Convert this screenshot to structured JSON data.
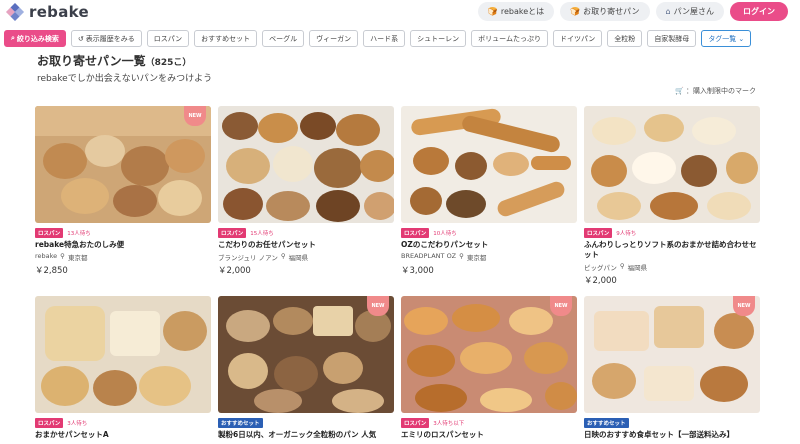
{
  "header": {
    "logo_text": "rebake",
    "nav": [
      {
        "label": "rebakeとは",
        "icon": "bread-icon"
      },
      {
        "label": "お取り寄せパン",
        "icon": "bread-icon"
      },
      {
        "label": "パン屋さん",
        "icon": "shop-icon"
      }
    ],
    "login_label": "ログイン"
  },
  "filters": {
    "refine_label": "絞り込み検索",
    "history_label": "表示履歴をみる",
    "tags": [
      "ロスパン",
      "おすすめセット",
      "ベーグル",
      "ヴィーガン",
      "ハード系",
      "シュトーレン",
      "ボリュームたっぷり",
      "ドイツパン",
      "全粒粉",
      "自家製酵母"
    ],
    "tag_list_label": "タグ一覧"
  },
  "main": {
    "title": "お取り寄せパン一覧",
    "count": "（825こ）",
    "subtitle": "rebakeでしか出会えないパンをみつけよう",
    "legend_label": "：購入制限中のマーク"
  },
  "products": [
    {
      "new": "NEW",
      "category": "ロスパン",
      "category_color": "#e23a73",
      "wait": "13人待ち",
      "name": "rebake特急おたのしみ便",
      "shop": "rebake",
      "location": "東京都",
      "price": "￥2,850"
    },
    {
      "new": "",
      "category": "ロスパン",
      "category_color": "#e23a73",
      "wait": "15人待ち",
      "name": "こだわりのお任せパンセット",
      "shop": "ブランジュリ ノアン",
      "location": "福岡県",
      "price": "￥2,000"
    },
    {
      "new": "",
      "category": "ロスパン",
      "category_color": "#e23a73",
      "wait": "10人待ち",
      "name": "OZのこだわりパンセット",
      "shop": "BREADPLANT OZ",
      "location": "東京都",
      "price": "￥3,000"
    },
    {
      "new": "",
      "category": "ロスパン",
      "category_color": "#e23a73",
      "wait": "9人待ち",
      "name": "ふんわりしっとりソフト系のおまかせ詰め合わせセット",
      "shop": "ピッグパン",
      "location": "福岡県",
      "price": "￥2,000"
    },
    {
      "new": "",
      "category": "ロスパン",
      "category_color": "#e23a73",
      "wait": "3人待ち",
      "name": "おまかせパンセットA",
      "shop": "",
      "location": "",
      "price": ""
    },
    {
      "new": "NEW",
      "category": "おすすめセット",
      "category_color": "#2b5fb4",
      "wait": "",
      "name": "製粉6日以内、オーガニック全粒粉のパン 人気",
      "shop": "",
      "location": "",
      "price": ""
    },
    {
      "new": "NEW",
      "category": "ロスパン",
      "category_color": "#e23a73",
      "wait": "3人待ち以下",
      "name": "エミリのロスパンセット",
      "shop": "",
      "location": "",
      "price": ""
    },
    {
      "new": "NEW",
      "category": "おすすめセット",
      "category_color": "#2b5fb4",
      "wait": "",
      "name": "日映のおすすめ食卓セット【一部送料込み】",
      "shop": "",
      "location": "",
      "price": ""
    }
  ]
}
